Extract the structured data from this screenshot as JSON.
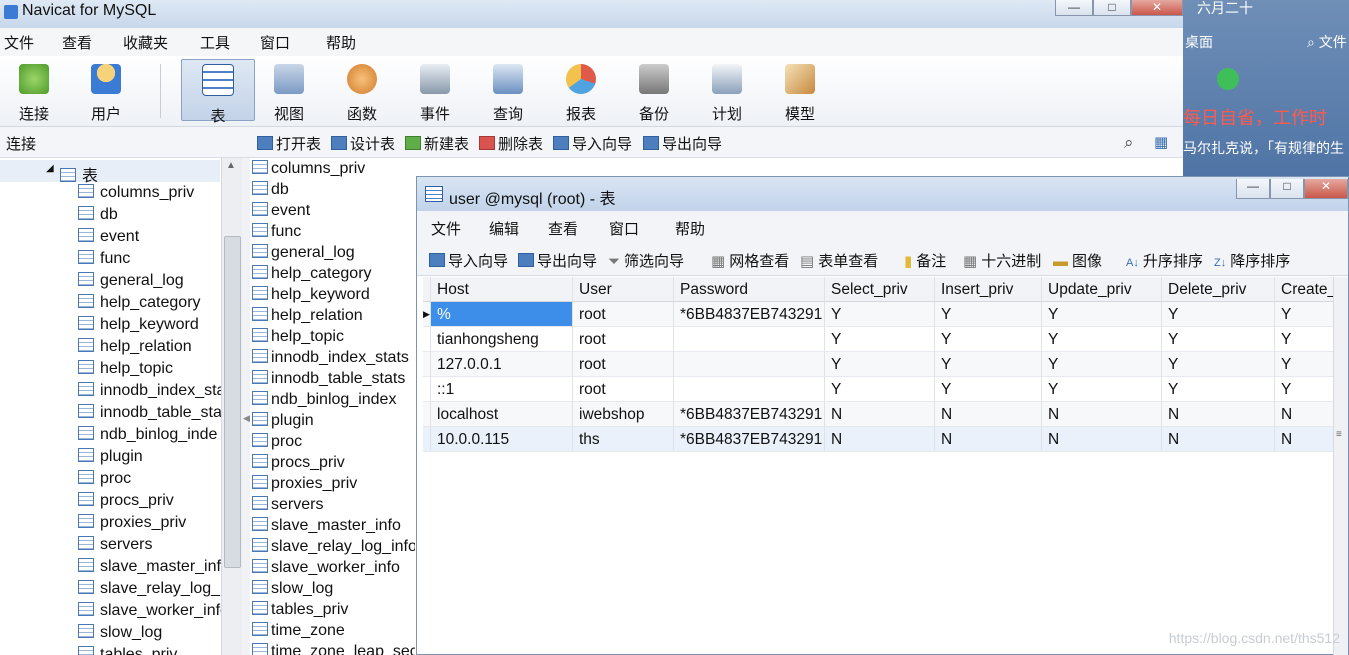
{
  "app": {
    "title": "Navicat for MySQL",
    "window_buttons": [
      "—",
      "□",
      "✕"
    ]
  },
  "menubar": [
    "文件",
    "查看",
    "收藏夹",
    "工具",
    "窗口",
    "帮助"
  ],
  "toolbar": [
    {
      "label": "连接",
      "icon": "connect-icon",
      "color": "#6cae3c"
    },
    {
      "label": "用户",
      "icon": "user-icon",
      "color": "#f0a640"
    },
    {
      "label": "表",
      "icon": "table-icon",
      "color": "#4d80c6"
    },
    {
      "label": "视图",
      "icon": "view-icon",
      "color": "#7b9ac4"
    },
    {
      "label": "函数",
      "icon": "function-icon",
      "color": "#d27a2b"
    },
    {
      "label": "事件",
      "icon": "event-icon",
      "color": "#8899aa"
    },
    {
      "label": "查询",
      "icon": "query-icon",
      "color": "#6b8fc0"
    },
    {
      "label": "报表",
      "icon": "report-icon",
      "color": "#e05a4a"
    },
    {
      "label": "备份",
      "icon": "backup-icon",
      "color": "#777777"
    },
    {
      "label": "计划",
      "icon": "schedule-icon",
      "color": "#8aa0bb"
    },
    {
      "label": "模型",
      "icon": "model-icon",
      "color": "#c6883e"
    }
  ],
  "subbar": {
    "left_label": "连接",
    "actions": [
      "打开表",
      "设计表",
      "新建表",
      "删除表",
      "导入向导",
      "导出向导"
    ]
  },
  "tree": {
    "root": "表",
    "items": [
      "columns_priv",
      "db",
      "event",
      "func",
      "general_log",
      "help_category",
      "help_keyword",
      "help_relation",
      "help_topic",
      "innodb_index_sta",
      "innodb_table_sta",
      "ndb_binlog_inde",
      "plugin",
      "proc",
      "procs_priv",
      "proxies_priv",
      "servers",
      "slave_master_info",
      "slave_relay_log_i",
      "slave_worker_info",
      "slow_log",
      "tables_priv"
    ]
  },
  "list": {
    "items": [
      "columns_priv",
      "db",
      "event",
      "func",
      "general_log",
      "help_category",
      "help_keyword",
      "help_relation",
      "help_topic",
      "innodb_index_stats",
      "innodb_table_stats",
      "ndb_binlog_index",
      "plugin",
      "proc",
      "procs_priv",
      "proxies_priv",
      "servers",
      "slave_master_info",
      "slave_relay_log_info",
      "slave_worker_info",
      "slow_log",
      "tables_priv",
      "time_zone",
      "time_zone_leap_sec"
    ]
  },
  "right_strip": {
    "top": "六月二十",
    "search": "文件",
    "desktop": "桌面",
    "banner": "每日自省，工作时",
    "quote": "马尔扎克说，「有规律的生"
  },
  "subwindow": {
    "title": "user @mysql (root) - 表",
    "menu": [
      "文件",
      "编辑",
      "查看",
      "窗口",
      "帮助"
    ],
    "tools": [
      "导入向导",
      "导出向导",
      "筛选向导",
      "网格查看",
      "表单查看",
      "备注",
      "十六进制",
      "图像",
      "升序排序",
      "降序排序"
    ],
    "columns": [
      "Host",
      "User",
      "Password",
      "Select_priv",
      "Insert_priv",
      "Update_priv",
      "Delete_priv",
      "Create_"
    ],
    "rows": [
      [
        "%",
        "root",
        "*6BB4837EB743291",
        "Y",
        "Y",
        "Y",
        "Y",
        "Y"
      ],
      [
        "tianhongsheng",
        "root",
        "",
        "Y",
        "Y",
        "Y",
        "Y",
        "Y"
      ],
      [
        "127.0.0.1",
        "root",
        "",
        "Y",
        "Y",
        "Y",
        "Y",
        "Y"
      ],
      [
        "::1",
        "root",
        "",
        "Y",
        "Y",
        "Y",
        "Y",
        "Y"
      ],
      [
        "localhost",
        "iwebshop",
        "*6BB4837EB743291",
        "N",
        "N",
        "N",
        "N",
        "N"
      ],
      [
        "10.0.0.115",
        "ths",
        "*6BB4837EB743291",
        "N",
        "N",
        "N",
        "N",
        "N"
      ]
    ],
    "selected_cell": "%"
  },
  "watermark": "https://blog.csdn.net/ths512"
}
